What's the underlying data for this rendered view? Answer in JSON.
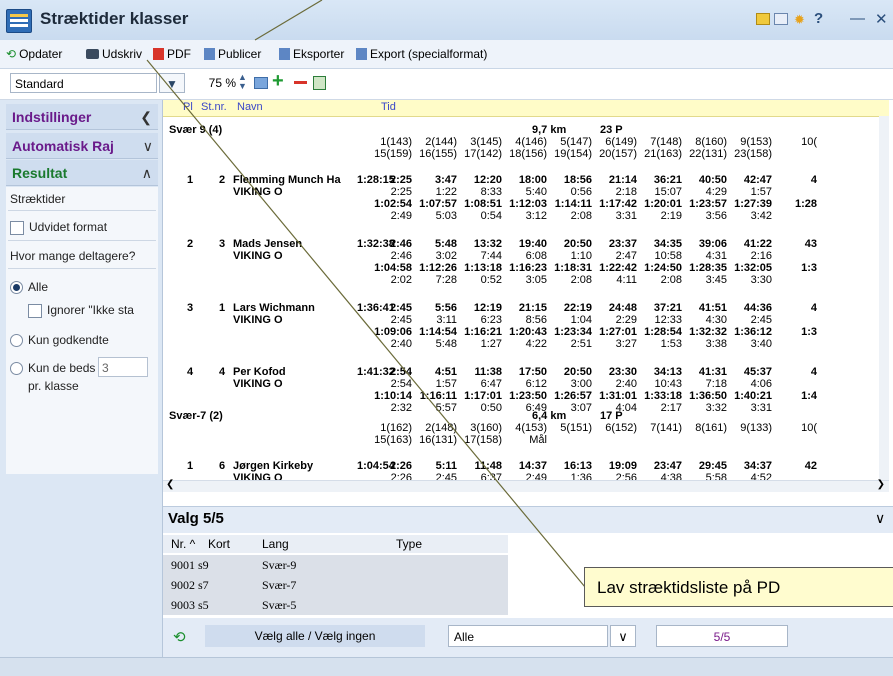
{
  "window": {
    "title": "Stræktider klasser",
    "controls": [
      "?",
      "—",
      "✕"
    ]
  },
  "toolbar": {
    "refresh": "Opdater",
    "print": "Udskriv",
    "pdf": "PDF",
    "publish": "Publicer",
    "export": "Eksporter",
    "export_special": "Export (specialformat)"
  },
  "toolbar2": {
    "view": "Standard",
    "zoom": "75 %"
  },
  "left": {
    "settings": "Indstillinger",
    "auto": "Automatisk Raj",
    "result": "Resultat",
    "split_times": "Stræktider",
    "extended_format": "Udvidet format",
    "how_many": "Hvor mange deltagere?",
    "all": "Alle",
    "ignore": "Ignorer \"Ikke sta",
    "approved_only": "Kun godkendte",
    "best_only": "Kun de beds",
    "best_value": "3",
    "per_class": "pr. klasse"
  },
  "report": {
    "headers": {
      "pl": "Pl",
      "stnr": "St.nr.",
      "name": "Navn",
      "time": "Tid"
    },
    "classes": [
      {
        "name": "Svær 9 (4)",
        "dist": "9,7 km",
        "points": "23 P",
        "controls_row1": [
          "1(143)",
          "2(144)",
          "3(145)",
          "4(146)",
          "5(147)",
          "6(149)",
          "7(148)",
          "8(160)",
          "9(153)",
          "10("
        ],
        "controls_row2": [
          "15(159)",
          "16(155)",
          "17(142)",
          "18(156)",
          "19(154)",
          "20(157)",
          "21(163)",
          "22(131)",
          "23(158)",
          ""
        ],
        "runners": [
          {
            "pl": "1",
            "stnr": "2",
            "name": "Flemming Munch Ha",
            "club": "VIKING O",
            "time": "1:28:15",
            "r1": [
              "2:25",
              "3:47",
              "12:20",
              "18:00",
              "18:56",
              "21:14",
              "36:21",
              "40:50",
              "42:47",
              "4"
            ],
            "r2": [
              "2:25",
              "1:22",
              "8:33",
              "5:40",
              "0:56",
              "2:18",
              "15:07",
              "4:29",
              "1:57",
              ""
            ],
            "r3": [
              "1:02:54",
              "1:07:57",
              "1:08:51",
              "1:12:03",
              "1:14:11",
              "1:17:42",
              "1:20:01",
              "1:23:57",
              "1:27:39",
              "1:28"
            ],
            "r4": [
              "2:49",
              "5:03",
              "0:54",
              "3:12",
              "2:08",
              "3:31",
              "2:19",
              "3:56",
              "3:42",
              ""
            ]
          },
          {
            "pl": "2",
            "stnr": "3",
            "name": "Mads Jensen",
            "club": "VIKING O",
            "time": "1:32:38",
            "r1": [
              "2:46",
              "5:48",
              "13:32",
              "19:40",
              "20:50",
              "23:37",
              "34:35",
              "39:06",
              "41:22",
              "43"
            ],
            "r2": [
              "2:46",
              "3:02",
              "7:44",
              "6:08",
              "1:10",
              "2:47",
              "10:58",
              "4:31",
              "2:16",
              ""
            ],
            "r3": [
              "1:04:58",
              "1:12:26",
              "1:13:18",
              "1:16:23",
              "1:18:31",
              "1:22:42",
              "1:24:50",
              "1:28:35",
              "1:32:05",
              "1:3"
            ],
            "r4": [
              "2:02",
              "7:28",
              "0:52",
              "3:05",
              "2:08",
              "4:11",
              "2:08",
              "3:45",
              "3:30",
              ""
            ]
          },
          {
            "pl": "3",
            "stnr": "1",
            "name": "Lars Wichmann",
            "club": "VIKING O",
            "time": "1:36:41",
            "r1": [
              "2:45",
              "5:56",
              "12:19",
              "21:15",
              "22:19",
              "24:48",
              "37:21",
              "41:51",
              "44:36",
              "4"
            ],
            "r2": [
              "2:45",
              "3:11",
              "6:23",
              "8:56",
              "1:04",
              "2:29",
              "12:33",
              "4:30",
              "2:45",
              ""
            ],
            "r3": [
              "1:09:06",
              "1:14:54",
              "1:16:21",
              "1:20:43",
              "1:23:34",
              "1:27:01",
              "1:28:54",
              "1:32:32",
              "1:36:12",
              "1:3"
            ],
            "r4": [
              "2:40",
              "5:48",
              "1:27",
              "4:22",
              "2:51",
              "3:27",
              "1:53",
              "3:38",
              "3:40",
              ""
            ]
          },
          {
            "pl": "4",
            "stnr": "4",
            "name": "Per Kofod",
            "club": "VIKING O",
            "time": "1:41:32",
            "r1": [
              "2:54",
              "4:51",
              "11:38",
              "17:50",
              "20:50",
              "23:30",
              "34:13",
              "41:31",
              "45:37",
              "4"
            ],
            "r2": [
              "2:54",
              "1:57",
              "6:47",
              "6:12",
              "3:00",
              "2:40",
              "10:43",
              "7:18",
              "4:06",
              ""
            ],
            "r3": [
              "1:10:14",
              "1:16:11",
              "1:17:01",
              "1:23:50",
              "1:26:57",
              "1:31:01",
              "1:33:18",
              "1:36:50",
              "1:40:21",
              "1:4"
            ],
            "r4": [
              "2:32",
              "5:57",
              "0:50",
              "6:49",
              "3:07",
              "4:04",
              "2:17",
              "3:32",
              "3:31",
              ""
            ]
          }
        ]
      },
      {
        "name": "Svær-7 (2)",
        "dist": "6,4 km",
        "points": "17 P",
        "controls_row1": [
          "1(162)",
          "2(148)",
          "3(160)",
          "4(153)",
          "5(151)",
          "6(152)",
          "7(141)",
          "8(161)",
          "9(133)",
          "10("
        ],
        "controls_row2": [
          "15(163)",
          "16(131)",
          "17(158)",
          "Mål",
          "",
          "",
          "",
          "",
          "",
          ""
        ],
        "runners": [
          {
            "pl": "1",
            "stnr": "6",
            "name": "Jørgen Kirkeby",
            "club": "VIKING O",
            "time": "1:04:54",
            "r1": [
              "2:26",
              "5:11",
              "11:48",
              "14:37",
              "16:13",
              "19:09",
              "23:47",
              "29:45",
              "34:37",
              "42"
            ],
            "r2": [
              "2:26",
              "2:45",
              "6:37",
              "2:49",
              "1:36",
              "2:56",
              "4:38",
              "5:58",
              "4:52",
              ""
            ]
          }
        ]
      }
    ]
  },
  "valg": {
    "title": "Valg  5/5",
    "columns": [
      "Nr. ^",
      "Kort",
      "Lang",
      "Type"
    ],
    "rows": [
      {
        "nr": "9001",
        "kort": "s9",
        "lang": "Svær-9"
      },
      {
        "nr": "9002",
        "kort": "s7",
        "lang": "Svær-7"
      },
      {
        "nr": "9003",
        "kort": "s5",
        "lang": "Svær-5"
      }
    ],
    "select_all": "Vælg alle / Vælg ingen",
    "filter": "Alle",
    "count": "5/5"
  },
  "tooltip": "Lav stræktidsliste på PD"
}
